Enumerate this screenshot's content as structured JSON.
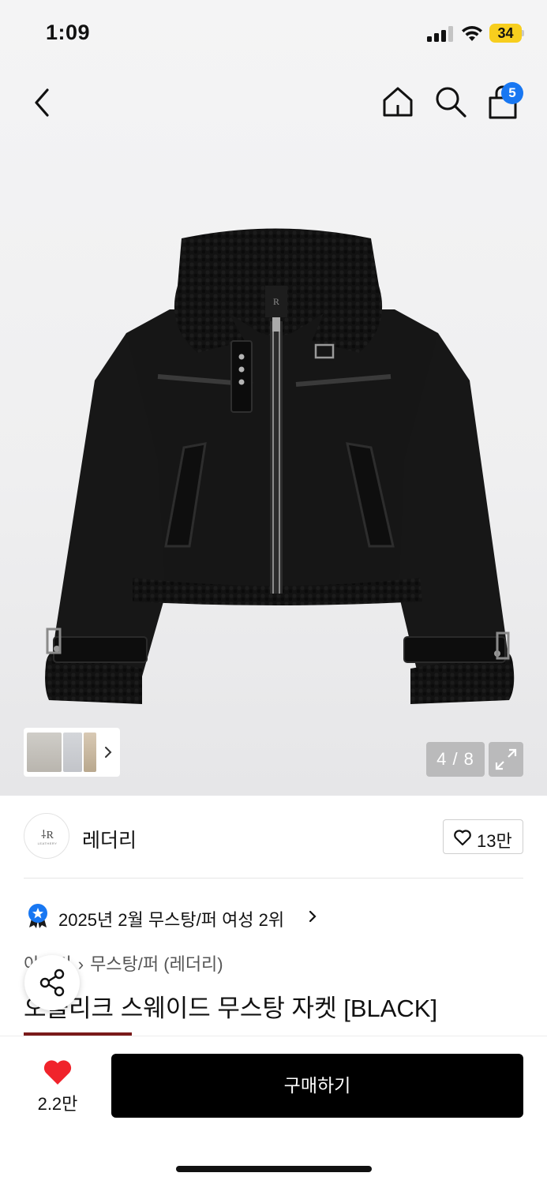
{
  "status_bar": {
    "time": "1:09",
    "battery_level": "34",
    "battery_color": "#f7ce1e",
    "signal_icon": "cellular-signal-icon",
    "wifi_icon": "wifi-icon"
  },
  "nav": {
    "back_icon": "chevron-left-icon",
    "home_icon": "home-icon",
    "search_icon": "search-icon",
    "cart_icon": "shopping-bag-icon",
    "cart_badge": "5",
    "badge_color": "#1877f2"
  },
  "gallery": {
    "counter": "4 / 8",
    "current_index": 4,
    "total": 8,
    "expand_icon": "expand-arrows-icon"
  },
  "brand": {
    "name": "레더리",
    "logo_text": "⸸R",
    "logo_sub": "LEATHERY",
    "like_count": "13만"
  },
  "ranking": {
    "text": "2025년 2월 무스탕/퍼 여성 2위"
  },
  "product": {
    "breadcrumb": [
      "아우터",
      "무스탕/퍼 (레더리)"
    ],
    "title": "오블리크 스웨이드 무스탕 자켓 [BLACK]"
  },
  "bottom_bar": {
    "wish_count": "2.2만",
    "heart_color": "#f0232b",
    "buy_label": "구매하기"
  }
}
